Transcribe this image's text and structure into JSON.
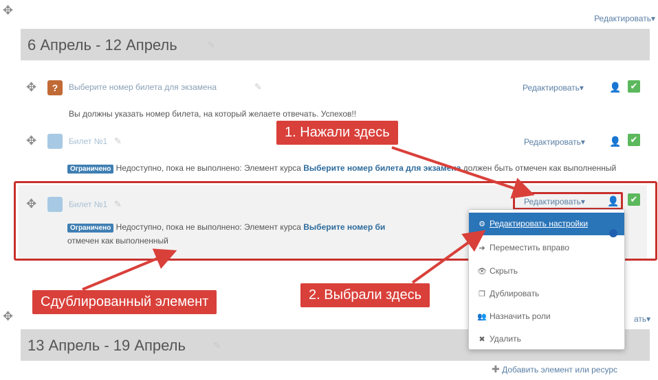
{
  "section1": {
    "edit_label": "Редактировать",
    "title": "6 Апрель - 12 Апрель",
    "activities": [
      {
        "name": "Выберите номер билета для экзамена",
        "edit_label": "Редактировать",
        "description": "Вы должны указать номер билета, на который желаете отвечать. Успехов!!"
      },
      {
        "name": "Билет №1",
        "edit_label": "Редактировать",
        "restriction_badge": "Ограничено",
        "restriction_text": "Недоступно, пока не выполнено: Элемент курса",
        "restriction_strong": "Выберите номер билета для экзамена",
        "restriction_tail": "должен быть отмечен как выполненный"
      },
      {
        "name": "Билет №1",
        "edit_label": "Редактировать",
        "restriction_badge": "Ограничено",
        "restriction_text": "Недоступно, пока не выполнено: Элемент курса",
        "restriction_strong": "Выберите номер би",
        "restriction_tail": "отмечен как выполненный"
      }
    ]
  },
  "section2": {
    "edit_label": "Редактировать",
    "edit_label_visible": "ать",
    "title": "13 Апрель - 19 Апрель",
    "add_label": "Добавить элемент или ресурс"
  },
  "dropdown_menu": {
    "items": [
      {
        "icon": "gear-icon",
        "label": "Редактировать настройки"
      },
      {
        "icon": "arrow-right-icon",
        "label": "Переместить вправо"
      },
      {
        "icon": "eye-icon",
        "label": "Скрыть"
      },
      {
        "icon": "copy-icon",
        "label": "Дублировать"
      },
      {
        "icon": "assign-roles-icon",
        "label": "Назначить роли"
      },
      {
        "icon": "delete-icon",
        "label": "Удалить"
      }
    ]
  },
  "annotations": {
    "step1": "1. Нажали здесь",
    "step2": "2. Выбрали здесь",
    "duplicated": "Сдублированный элемент"
  },
  "colors": {
    "callout_red": "#d9403a",
    "highlight_border": "#c9302c",
    "menu_active": "#2a74b8",
    "check_green": "#5cb85c",
    "restriction_badge": "#3f7fb3"
  }
}
